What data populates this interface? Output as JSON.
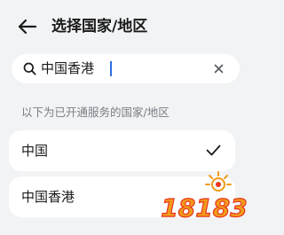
{
  "header": {
    "title": "选择国家/地区",
    "back_icon": "arrow-left-icon"
  },
  "search": {
    "value": "中国香港",
    "icon": "search-icon",
    "clear_icon": "close-icon",
    "caret_color": "#2f6fdf"
  },
  "section": {
    "label": "以下为已开通服务的国家/地区"
  },
  "regions": [
    {
      "label": "中国",
      "selected": true,
      "selected_icon": "checkmark-icon"
    },
    {
      "label": "中国香港",
      "selected": false
    }
  ],
  "watermark": {
    "text": "18183",
    "colors": [
      "#f29a1b",
      "#e8351f"
    ]
  },
  "colors": {
    "background": "#f1f3f5",
    "card": "#ffffff",
    "text": "#1a1a1a",
    "secondary_text": "#7a7f85"
  }
}
